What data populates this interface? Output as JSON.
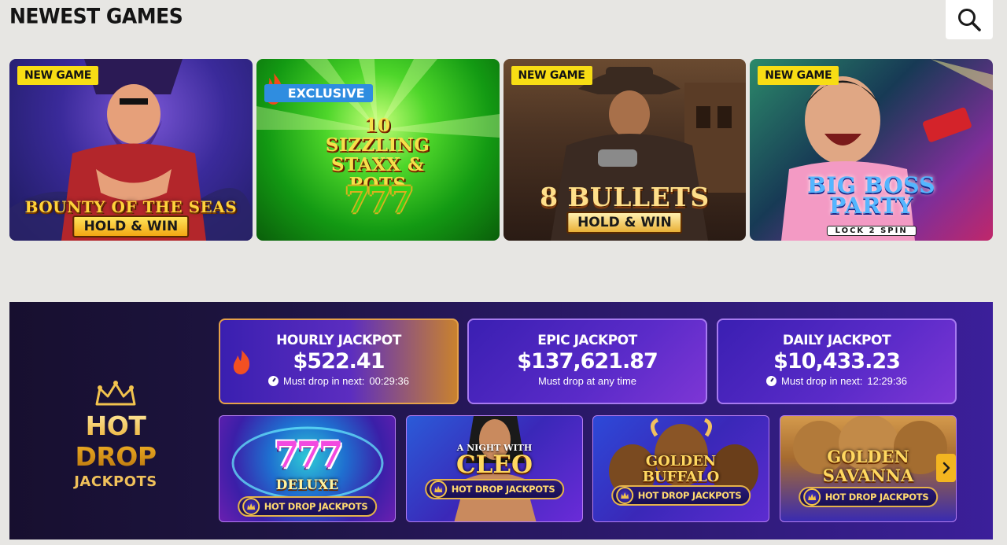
{
  "header": {
    "title": "NEWEST GAMES",
    "search_icon": "search-icon"
  },
  "games": [
    {
      "badge": "NEW GAME",
      "title": "BOUNTY OF THE SEAS",
      "subtitle": "HOLD & WIN"
    },
    {
      "badge": "EXCLUSIVE",
      "title": "10 SIZZLING STAXX & POTS",
      "subtitle": "777"
    },
    {
      "badge": "NEW GAME",
      "title": "8 BULLETS",
      "subtitle": "HOLD & WIN"
    },
    {
      "badge": "NEW GAME",
      "title": "BIG BOSS PARTY",
      "subtitle": "LOCK 2 SPIN"
    }
  ],
  "jackpot": {
    "logo_title": "HOT DROP",
    "logo_subtitle": "JACKPOTS",
    "cards": [
      {
        "name": "HOURLY JACKPOT",
        "amount": "$522.41",
        "drop_label": "Must drop in next:",
        "drop_time": "00:29:36"
      },
      {
        "name": "EPIC JACKPOT",
        "amount": "$137,621.87",
        "drop_label": "Must drop at any time",
        "drop_time": ""
      },
      {
        "name": "DAILY JACKPOT",
        "amount": "$10,433.23",
        "drop_label": "Must drop in next:",
        "drop_time": "12:29:36"
      }
    ],
    "tiles": [
      {
        "title": "777",
        "subtitle": "DELUXE",
        "pill": "HOT DROP JACKPOTS"
      },
      {
        "title": "CLEO",
        "subtitle": "A NIGHT WITH",
        "pill": "HOT DROP JACKPOTS"
      },
      {
        "title": "GOLDEN BUFFALO",
        "subtitle": "",
        "pill": "HOT DROP JACKPOTS"
      },
      {
        "title": "GOLDEN SAVANNA",
        "subtitle": "",
        "pill": "HOT DROP JACKPOTS"
      }
    ]
  }
}
